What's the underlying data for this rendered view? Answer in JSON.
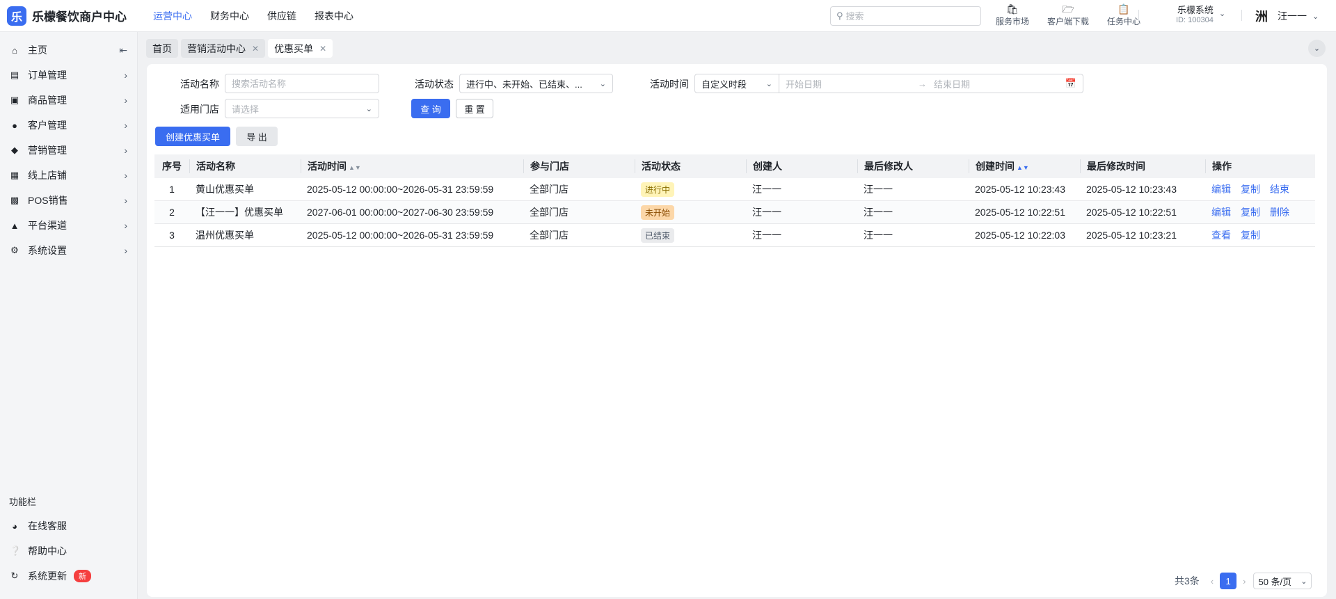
{
  "header": {
    "brand": "乐檬餐饮商户中心",
    "logo_glyph": "乐",
    "nav": [
      "运营中心",
      "财务中心",
      "供应链",
      "报表中心"
    ],
    "search_placeholder": "搜索",
    "tools": [
      {
        "label": "服务市场",
        "icon": "shop-icon"
      },
      {
        "label": "客户端下载",
        "icon": "folder-download-icon"
      },
      {
        "label": "任务中心",
        "icon": "clipboard-icon"
      }
    ],
    "system_name": "乐檬系统",
    "system_id": "ID: 100304",
    "avatar_glyph": "洲",
    "user_name": "汪一一"
  },
  "sidebar": {
    "items": [
      {
        "label": "主页",
        "icon": "home-icon"
      },
      {
        "label": "订单管理",
        "icon": "order-icon"
      },
      {
        "label": "商品管理",
        "icon": "goods-icon"
      },
      {
        "label": "客户管理",
        "icon": "user-icon"
      },
      {
        "label": "营销管理",
        "icon": "tag-icon"
      },
      {
        "label": "线上店铺",
        "icon": "store-icon"
      },
      {
        "label": "POS销售",
        "icon": "pos-icon"
      },
      {
        "label": "平台渠道",
        "icon": "bank-icon"
      },
      {
        "label": "系统设置",
        "icon": "gear-icon"
      }
    ],
    "bottom_title": "功能栏",
    "bottom_items": [
      {
        "label": "在线客服",
        "icon": "headset-icon"
      },
      {
        "label": "帮助中心",
        "icon": "help-icon"
      },
      {
        "label": "系统更新",
        "icon": "refresh-icon",
        "badge": "新"
      }
    ]
  },
  "tabs": [
    {
      "label": "首页",
      "closable": false
    },
    {
      "label": "营销活动中心",
      "closable": true
    },
    {
      "label": "优惠买单",
      "closable": true,
      "active": true
    }
  ],
  "filters": {
    "name_label": "活动名称",
    "name_placeholder": "搜索活动名称",
    "status_label": "活动状态",
    "status_value": "进行中、未开始、已结束、...",
    "time_label": "活动时间",
    "time_mode": "自定义时段",
    "start_placeholder": "开始日期",
    "end_placeholder": "结束日期",
    "store_label": "适用门店",
    "store_placeholder": "请选择",
    "query_button": "查 询",
    "reset_button": "重 置"
  },
  "actions": {
    "create_button": "创建优惠买单",
    "export_button": "导 出"
  },
  "table": {
    "columns": [
      "序号",
      "活动名称",
      "活动时间",
      "参与门店",
      "活动状态",
      "创建人",
      "最后修改人",
      "创建时间",
      "最后修改时间",
      "操作"
    ],
    "rows": [
      {
        "no": "1",
        "name": "黄山优惠买单",
        "time": "2025-05-12 00:00:00~2026-05-31 23:59:59",
        "store": "全部门店",
        "status": "进行中",
        "status_type": "running",
        "creator": "汪一一",
        "modifier": "汪一一",
        "created": "2025-05-12 10:23:43",
        "modified": "2025-05-12 10:23:43",
        "ops": [
          "编辑",
          "复制",
          "结束"
        ]
      },
      {
        "no": "2",
        "name": "【汪一一】优惠买单",
        "time": "2027-06-01 00:00:00~2027-06-30 23:59:59",
        "store": "全部门店",
        "status": "未开始",
        "status_type": "pending",
        "creator": "汪一一",
        "modifier": "汪一一",
        "created": "2025-05-12 10:22:51",
        "modified": "2025-05-12 10:22:51",
        "ops": [
          "编辑",
          "复制",
          "删除"
        ]
      },
      {
        "no": "3",
        "name": "温州优惠买单",
        "time": "2025-05-12 00:00:00~2026-05-31 23:59:59",
        "store": "全部门店",
        "status": "已结束",
        "status_type": "ended",
        "creator": "汪一一",
        "modifier": "汪一一",
        "created": "2025-05-12 10:22:03",
        "modified": "2025-05-12 10:23:21",
        "ops": [
          "查看",
          "复制"
        ]
      }
    ]
  },
  "pagination": {
    "total": "共3条",
    "current_page": "1",
    "page_size": "50 条/页"
  },
  "colors": {
    "primary": "#3a6df0",
    "running_bg": "#fff4b8",
    "pending_bg": "#fcd7a8",
    "ended_bg": "#eaebed",
    "badge_red": "#f53f3f"
  }
}
